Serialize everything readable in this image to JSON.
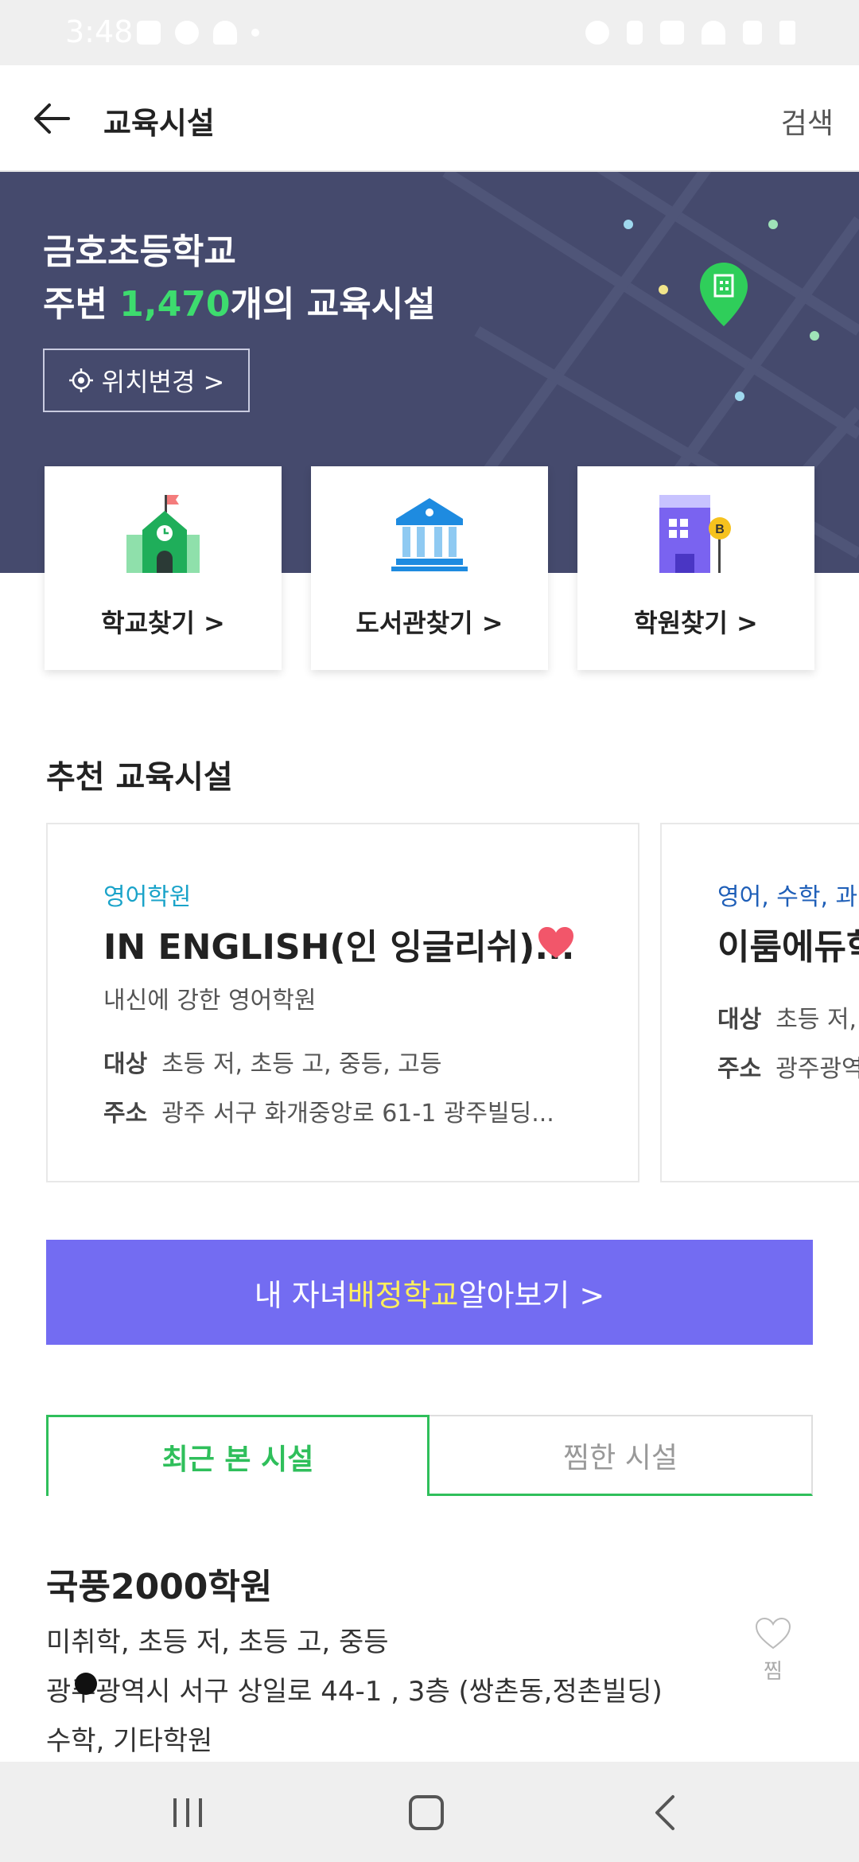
{
  "status_bar": {
    "time": "3:48"
  },
  "app_bar": {
    "title": "교육시설",
    "search_label": "검색"
  },
  "hero": {
    "school_name": "금호초등학교",
    "prefix": "주변 ",
    "count": "1,470",
    "suffix": "개의 교육시설",
    "location_button": "위치변경 >"
  },
  "categories": [
    {
      "label": "학교찾기 >",
      "icon": "school-icon"
    },
    {
      "label": "도서관찾기 >",
      "icon": "library-icon"
    },
    {
      "label": "학원찾기 >",
      "icon": "academy-icon"
    }
  ],
  "recommended": {
    "title": "추천 교육시설",
    "cards": [
      {
        "category": "영어학원",
        "name": "IN ENGLISH(인 잉글리쉬)...",
        "description": "내신에 강한 영어학원",
        "target_label": "대상",
        "target": "초등 저, 초등 고, 중등, 고등",
        "address_label": "주소",
        "address": "광주 서구 화개중앙로 61-1 광주빌딩...",
        "favorited": true
      },
      {
        "category": "영어, 수학, 과",
        "name": "이룸에듀학",
        "target_label": "대상",
        "target": "초등 저,",
        "address_label": "주소",
        "address": "광주광역"
      }
    ]
  },
  "banner": {
    "prefix": "내 자녀 ",
    "highlight": "배정학교",
    "suffix": " 알아보기 >"
  },
  "tabs": {
    "recent": "최근 본 시설",
    "favorites": "찜한 시설"
  },
  "recent_item": {
    "name": "국풍2000학원",
    "targets": "미취학, 초등 저, 초등 고, 중등",
    "address": "광주광역시 서구 상일로 44-1 , 3층 (쌍촌동,정촌빌딩)",
    "subjects": "수학, 기타학원",
    "bookmark_label": "찜"
  },
  "colors": {
    "hero_bg": "#454a6d",
    "accent_green": "#2fbf5b",
    "banner_bg": "#736cf2",
    "banner_highlight": "#ffef5c",
    "heart": "#f2566a"
  }
}
